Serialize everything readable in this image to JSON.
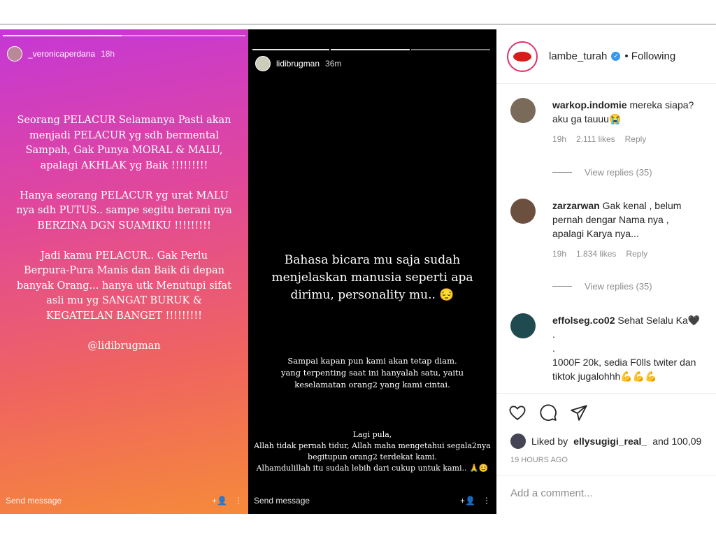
{
  "story_left": {
    "username": "_veronicaperdana",
    "time": "18h",
    "text": "Seorang PELACUR Selamanya Pasti akan\nmenjadi PELACUR yg sdh bermental\nSampah, Gak Punya MORAL & MALU,\napalagi AKHLAK yg Baik !!!!!!!!!\n\nHanya seorang PELACUR yg urat MALU\nnya sdh PUTUS.. sampe segitu berani nya\nBERZINA DGN SUAMIKU !!!!!!!!!\n\nJadi kamu PELACUR.. Gak Perlu\nBerpura-Pura Manis dan Baik di depan\nbanyak Orang... hanya utk Menutupi sifat\nasli mu yg SANGAT BURUK &\nKEGATELAN BANGET !!!!!!!!!\n\n@lidibrugman",
    "send_message": "Send message",
    "add_icon": "+👤",
    "more_icon": "⋮"
  },
  "story_right": {
    "username": "lidibrugman",
    "time": "36m",
    "text_main": "Bahasa bicara mu saja sudah\nmenjelaskan manusia seperti apa\ndirimu, personality mu.. 😔",
    "text_mid": "Sampai kapan pun kami akan tetap diam.\nyang terpenting saat ini hanyalah satu, yaitu\nkeselamatan orang2 yang kami cintai.",
    "text_bottom": "Lagi pula,\nAllah tidak pernah tidur, Allah maha mengetahui segala2nya\nbegitupun orang2 terdekat kami.\nAlhamdulillah itu sudah lebih dari cukup untuk kami.. 🙏😊",
    "send_message": "Send message",
    "add_icon": "+👤",
    "more_icon": "⋮"
  },
  "post": {
    "username": "lambe_turah",
    "verified": "✓",
    "following": "• Following",
    "comments": [
      {
        "user": "warkop.indomie",
        "text": "mereka siapa?\naku ga tauuu😭",
        "time": "19h",
        "likes": "2.111 likes",
        "reply": "Reply",
        "view_replies": "View replies (35)",
        "avatar_color": "#7a6a5a"
      },
      {
        "user": "zarzarwan",
        "text": "Gak kenal , belum\npernah dengar Nama nya ,\napalagi Karya nya...",
        "time": "19h",
        "likes": "1.834 likes",
        "reply": "Reply",
        "view_replies": "View replies (35)",
        "avatar_color": "#6b5040"
      },
      {
        "user": "effolseg.co02",
        "text": "Sehat Selalu Ka🖤\n.\n.\n1000F 20k, sedia F0lls twiter dan\ntiktok jugalohhh💪💪💪",
        "avatar_color": "#1f4a4f"
      }
    ],
    "liked_by_prefix": "Liked by",
    "liked_by_user": "ellysugigi_real_",
    "liked_by_suffix": "and 100,09",
    "time_ago": "19 HOURS AGO",
    "add_comment_placeholder": "Add a comment..."
  }
}
